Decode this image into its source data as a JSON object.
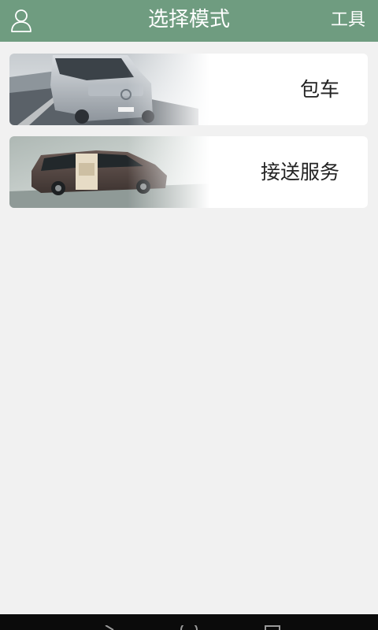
{
  "header": {
    "title": "选择模式",
    "tools_label": "工具",
    "user_icon": "user-icon"
  },
  "cards": [
    {
      "label": "包车",
      "image": "van-photo"
    },
    {
      "label": "接送服务",
      "image": "minivan-photo"
    }
  ],
  "colors": {
    "header_bg": "#6f9c80",
    "page_bg": "#f1f1f1",
    "card_bg": "#ffffff",
    "nav_bg": "#0b0b0b"
  }
}
